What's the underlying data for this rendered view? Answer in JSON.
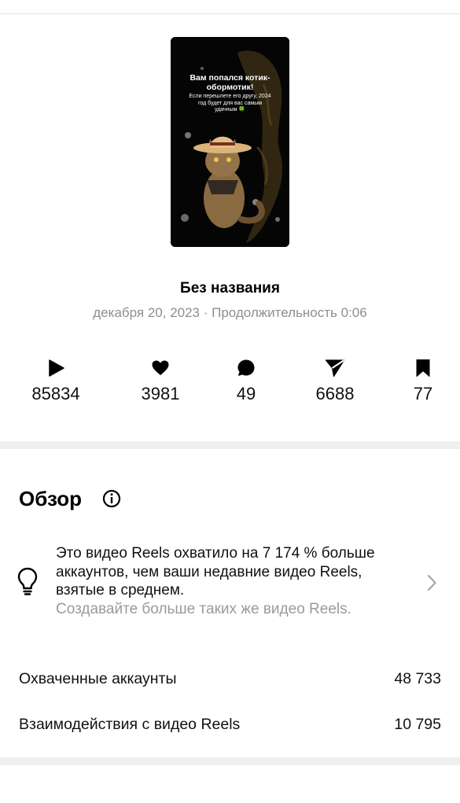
{
  "reel": {
    "thumbnail": {
      "title": "Вам попался котик-обормотик!",
      "subtitle": "Если перешлете его другу, 2024 год будет для вас самым удачным 🍀"
    },
    "title": "Без названия",
    "meta": "декабря 20, 2023 · Продолжительность 0:06"
  },
  "stats": [
    {
      "icon": "play-icon",
      "value": "85834"
    },
    {
      "icon": "heart-icon",
      "value": "3981"
    },
    {
      "icon": "comment-icon",
      "value": "49"
    },
    {
      "icon": "share-icon",
      "value": "6688"
    },
    {
      "icon": "bookmark-icon",
      "value": "77"
    }
  ],
  "overview": {
    "title": "Обзор",
    "insight": {
      "text": "Это видео Reels охватило на 7 174 % больше аккаунтов, чем ваши недавние видео Reels, взятые в среднем.",
      "hint": "Создавайте больше таких же видео Reels."
    },
    "metrics": [
      {
        "label": "Охваченные аккаунты",
        "value": "48 733"
      },
      {
        "label": "Взаимодействия с видео Reels",
        "value": "10 795"
      }
    ]
  },
  "colors": {
    "text": "#000000",
    "secondary": "#8e8e8e",
    "divider": "#efefef"
  }
}
